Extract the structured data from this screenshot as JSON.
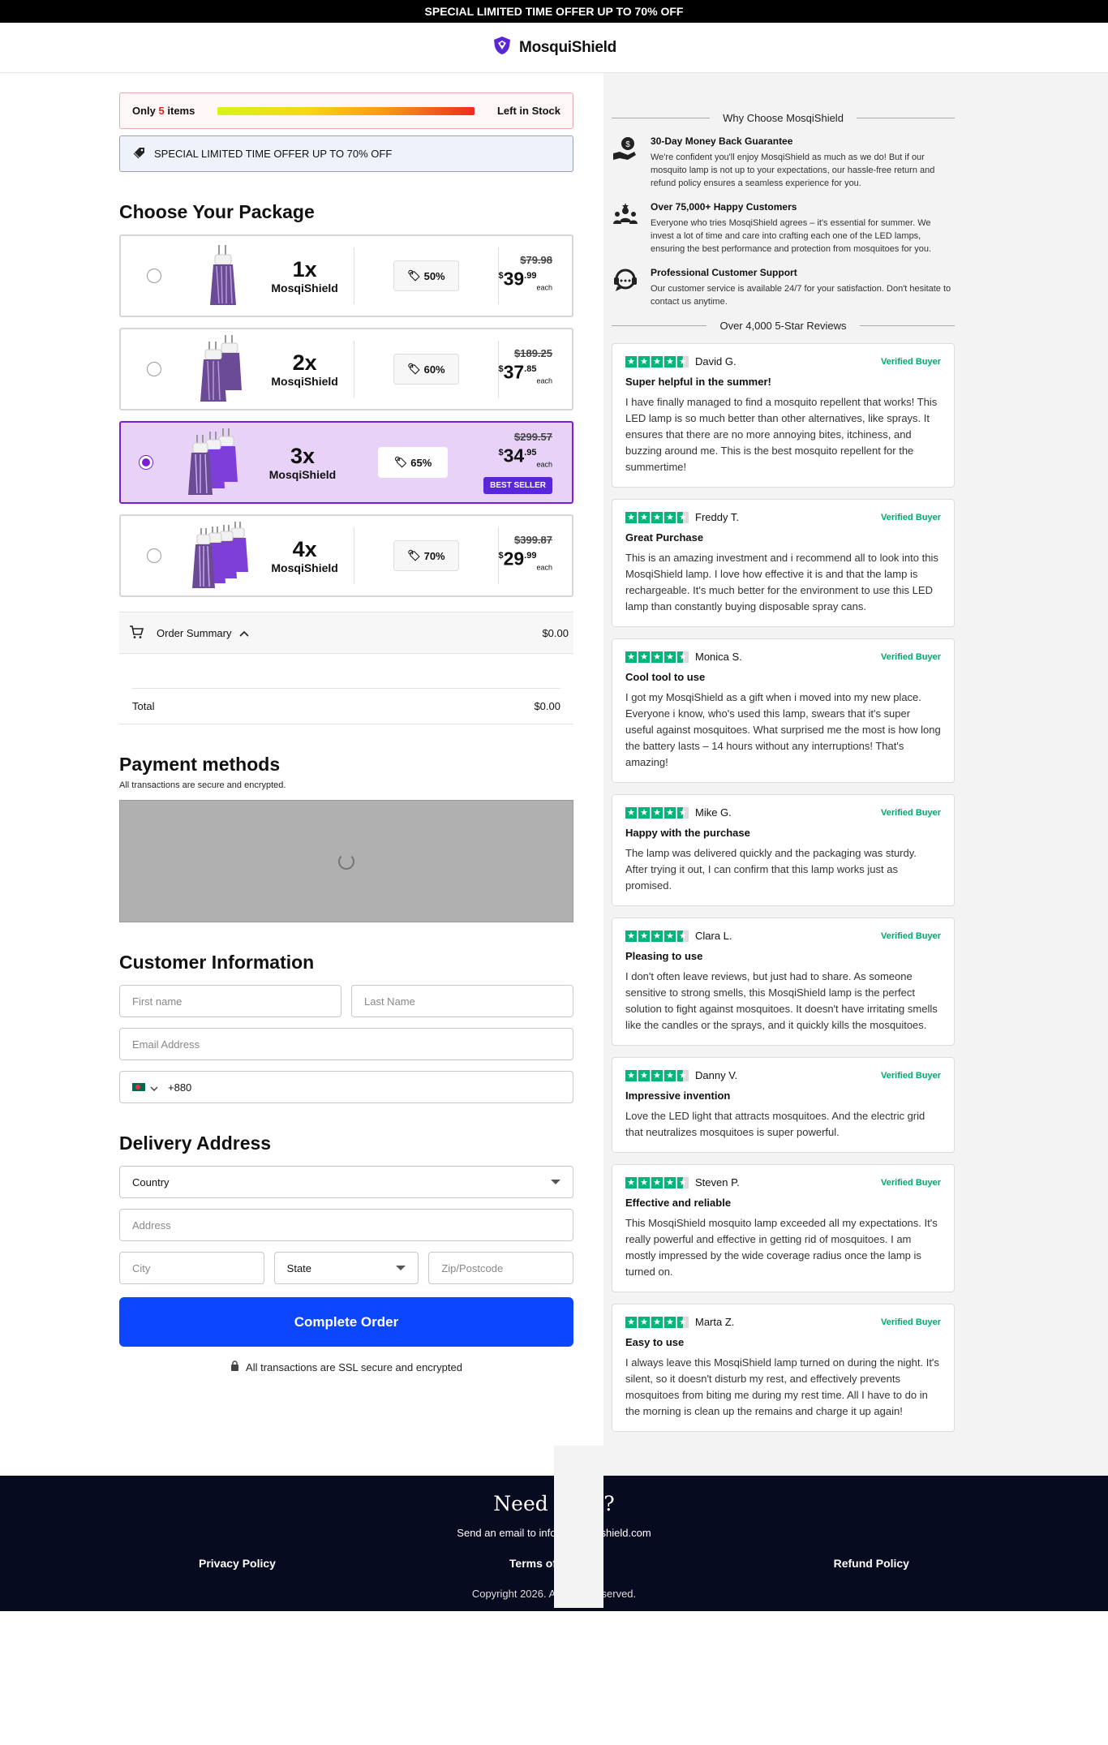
{
  "topbar": {
    "text": "SPECIAL LIMITED TIME OFFER UP TO 70% OFF"
  },
  "brand": {
    "name": "MosquiShield",
    "color": "#5a27d8"
  },
  "stock": {
    "prefix": "Only",
    "count": "5",
    "suffix": "items",
    "right": "Left in Stock"
  },
  "offer_banner": {
    "text": "SPECIAL LIMITED TIME OFFER UP TO 70% OFF",
    "icon": "tag-icon"
  },
  "package_section": {
    "title": "Choose Your Package"
  },
  "packages": [
    {
      "qty": "1x",
      "name": "MosqiShield",
      "discount": "50%",
      "old_price": "$79.98",
      "price_whole": "39",
      "price_cents": ".99",
      "each": "each",
      "selected": false
    },
    {
      "qty": "2x",
      "name": "MosqiShield",
      "discount": "60%",
      "old_price": "$189.25",
      "price_whole": "37",
      "price_cents": ".85",
      "each": "each",
      "selected": false
    },
    {
      "qty": "3x",
      "name": "MosqiShield",
      "discount": "65%",
      "old_price": "$299.57",
      "price_whole": "34",
      "price_cents": ".95",
      "each": "each",
      "badge": "BEST SELLER",
      "selected": true
    },
    {
      "qty": "4x",
      "name": "MosqiShield",
      "discount": "70%",
      "old_price": "$399.87",
      "price_whole": "29",
      "price_cents": ".99",
      "each": "each",
      "selected": false
    }
  ],
  "currency_symbol": "$",
  "order_summary": {
    "label": "Order Summary",
    "amount": "$0.00",
    "total_label": "Total",
    "total_amount": "$0.00"
  },
  "payment": {
    "title": "Payment methods",
    "subtitle": "All transactions are secure and encrypted."
  },
  "customer": {
    "title": "Customer Information",
    "first_name_placeholder": "First name",
    "last_name_placeholder": "Last Name",
    "email_placeholder": "Email Address",
    "phone_value": "+880"
  },
  "delivery": {
    "title": "Delivery Address",
    "country_value": "Country",
    "address_placeholder": "Address",
    "city_placeholder": "City",
    "state_value": "State",
    "zip_placeholder": "Zip/Postcode"
  },
  "cta": {
    "label": "Complete Order"
  },
  "ssl_note": "All transactions are SSL secure and encrypted",
  "why": {
    "title": "Why Choose MosqiShield",
    "features": [
      {
        "icon": "money-back-icon",
        "title": "30-Day Money Back Guarantee",
        "text": "We're confident you'll enjoy MosqiShield as much as we do! But if our mosquito lamp is not up to your expectations, our hassle-free return and refund policy ensures a seamless experience for you."
      },
      {
        "icon": "customers-icon",
        "title": "Over 75,000+ Happy Customers",
        "text": "Everyone who tries MosqiShield agrees – it's essential for summer. We invest a lot of time and care into crafting each one of the LED lamps, ensuring the best performance and protection from mosquitoes for you."
      },
      {
        "icon": "support-icon",
        "title": "Professional Customer Support",
        "text": "Our customer service is available 24/7 for your satisfaction. Don't hesitate to contact us anytime."
      }
    ]
  },
  "reviews": {
    "title": "Over 4,000 5-Star Reviews",
    "verified_label": "Verified Buyer",
    "star_color": "#00b67a",
    "items": [
      {
        "name": "David G.",
        "title": "Super helpful in the summer!",
        "text": "I have finally managed to find a mosquito repellent that works! This LED lamp is so much better than other alternatives, like sprays. It ensures that there are no more annoying bites, itchiness, and buzzing around me. This is the best mosquito repellent for the summertime!"
      },
      {
        "name": "Freddy T.",
        "title": "Great Purchase",
        "text": "This is an amazing investment and i recommend all to look into this MosqiShield lamp. I love how effective it is and that the lamp is rechargeable. It's much better for the environment to use this LED lamp than constantly buying disposable spray cans."
      },
      {
        "name": "Monica S.",
        "title": "Cool tool to use",
        "text": "I got my MosqiShield as a gift when i moved into my new place. Everyone i know, who's used this lamp, swears that it's super useful against mosquitoes. What surprised me the most is how long the battery lasts – 14 hours without any interruptions! That's amazing!"
      },
      {
        "name": "Mike G.",
        "title": "Happy with the purchase",
        "text": "The lamp was delivered quickly and the packaging was sturdy. After trying it out, I can confirm that this lamp works just as promised."
      },
      {
        "name": "Clara L.",
        "title": "Pleasing to use",
        "text": "I don't often leave reviews, but just had to share. As someone sensitive to strong smells, this MosqiShield lamp is the perfect solution to fight against mosquitoes. It doesn't have irritating smells like the candles or the sprays, and it quickly kills the mosquitoes."
      },
      {
        "name": "Danny V.",
        "title": "Impressive invention",
        "text": "Love the LED light that attracts mosquitoes. And the electric grid that neutralizes mosquitoes is super powerful."
      },
      {
        "name": "Steven P.",
        "title": "Effective and reliable",
        "text": "This MosqiShield mosquito lamp exceeded all my expectations. It's really powerful and effective in getting rid of mosquitoes. I am mostly impressed by the wide coverage radius once the lamp is turned on."
      },
      {
        "name": "Marta Z.",
        "title": "Easy to use",
        "text": "I always leave this MosqiShield lamp turned on during the night. It's silent, so it doesn't disturb my rest, and effectively prevents mosquitoes from biting me during my rest time. All I have to do in the morning is clean up the remains and charge it up again!"
      }
    ]
  },
  "footer": {
    "help": "Need Help?",
    "email_text": "Send an email to info@mosquishield.com",
    "links": [
      "Privacy Policy",
      "Terms of Service",
      "Refund Policy"
    ],
    "copyright": "Copyright 2026. All rights reserved."
  }
}
